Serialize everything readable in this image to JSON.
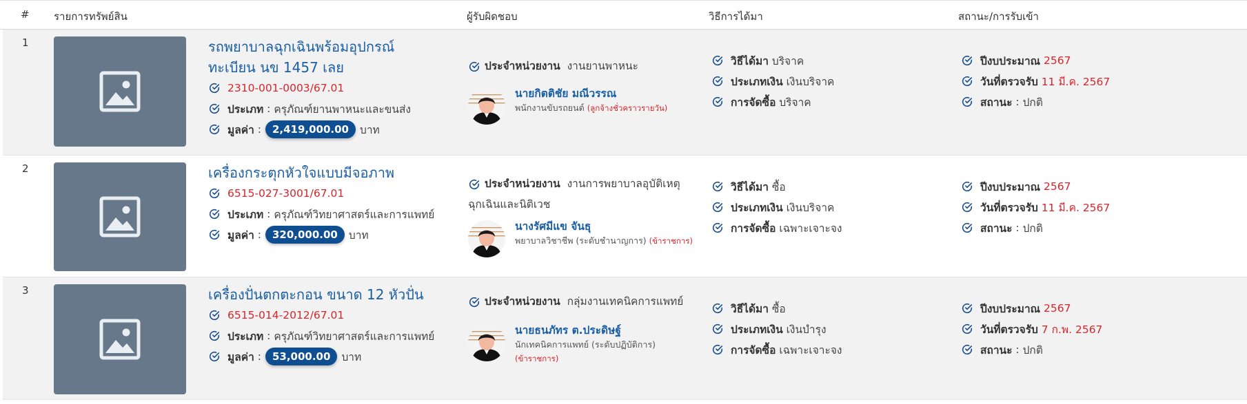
{
  "header": {
    "col_no": "#",
    "col_item": "รายการทรัพย์สิน",
    "col_resp": "ผู้รับผิดชอบ",
    "col_acq": "วิธีการได้มา",
    "col_status": "สถานะ/การรับเข้า"
  },
  "labels": {
    "type": "ประเภท",
    "value": "มูลค่า",
    "baht": "บาท",
    "unit": "ประจำหน่วยงาน",
    "acq_method": "วิธีได้มา",
    "fund_type": "ประเภทเงิน",
    "procure": "การจัดซื้อ",
    "budget_year": "ปีงบประมาณ",
    "inspect_date": "วันที่ตรวจรับ",
    "status": "สถานะ",
    "colon": ":"
  },
  "rows": [
    {
      "no": "1",
      "title": "รถพยาบาลฉุกเฉินพร้อมอุปกรณ์ ทะเบียน นข 1457 เลย",
      "code": "2310-001-0003/67.01",
      "type": "ครุภัณฑ์ยานพาหนะและขนส่ง",
      "value": "2,419,000.00",
      "unit": "งานยานพาหนะ",
      "person_name": "นายกิตติชัย มณีวรรณ",
      "person_role": "พนักงานขับรถยนต์",
      "person_tag": "(ลูกจ้างชั่วคราวรายวัน)",
      "acq_method": "บริจาค",
      "fund_type": "เงินบริจาค",
      "procure": "บริจาค",
      "budget_year": "2567",
      "inspect_date": "11 มี.ค. 2567",
      "status": "ปกติ"
    },
    {
      "no": "2",
      "title": "เครื่องกระตุกหัวใจแบบมีจอภาพ",
      "code": "6515-027-3001/67.01",
      "type": "ครุภัณฑ์วิทยาศาสตร์และการแพทย์",
      "value": "320,000.00",
      "unit": "งานการพยาบาลอุบัติเหตุฉุกเฉินและนิติเวช",
      "person_name": "นางรัศมีแข จันธุ",
      "person_role": "พยาบาลวิชาชีพ (ระดับชำนาญการ)",
      "person_tag": "(ข้าราชการ)",
      "acq_method": "ซื้อ",
      "fund_type": "เงินบริจาค",
      "procure": "เฉพาะเจาะจง",
      "budget_year": "2567",
      "inspect_date": "11 มี.ค. 2567",
      "status": "ปกติ"
    },
    {
      "no": "3",
      "title": "เครื่องปั่นตกตะกอน ขนาด 12 หัวปั่น",
      "code": "6515-014-2012/67.01",
      "type": "ครุภัณฑ์วิทยาศาสตร์และการแพทย์",
      "value": "53,000.00",
      "unit": "กลุ่มงานเทคนิคการแพทย์",
      "person_name": "นายธนภัทร ต.ประดิษฐ์",
      "person_role": "นักเทคนิคการแพทย์ (ระดับปฏิบัติการ)",
      "person_tag": "(ข้าราชการ)",
      "acq_method": "ซื้อ",
      "fund_type": "เงินบำรุง",
      "procure": "เฉพาะเจาะจง",
      "budget_year": "2567",
      "inspect_date": "7 ก.พ. 2567",
      "status": "ปกติ"
    }
  ],
  "colors": {
    "title_blue": "#1a5fa3",
    "code_red": "#d9252b",
    "pill_blue": "#0e4e91",
    "thumb_grey": "#66788a",
    "row_grey": "#f2f2f2"
  },
  "icons": {
    "check": "check-circle-icon",
    "thumb": "image-placeholder-icon",
    "avatar": "user-avatar"
  }
}
